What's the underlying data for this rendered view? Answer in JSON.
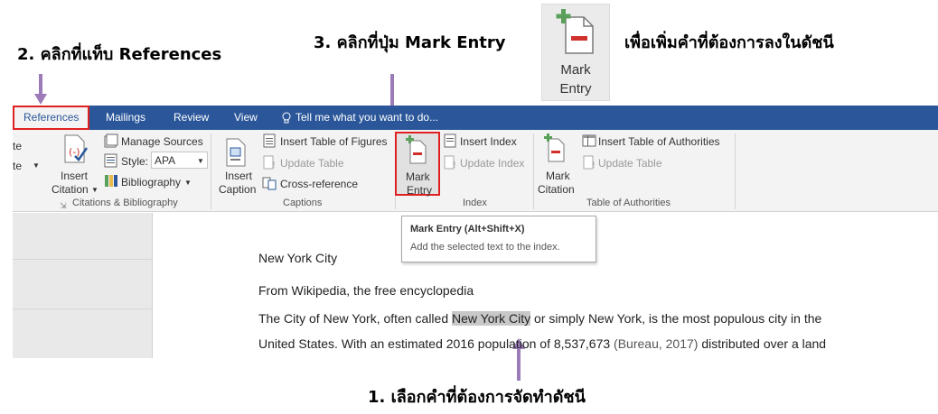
{
  "annotations": {
    "step1": "1. เลือกคำที่ต้องการจัดทำดัชนี",
    "step2": "2. คลิกที่แท็บ References",
    "step3": "3. คลิกที่ปุ่ม Mark Entry",
    "step3_suffix": "เพื่อเพิ่มคำที่ต้องการลงในดัชนี",
    "big_icon_line1": "Mark",
    "big_icon_line2": "Entry"
  },
  "tabs": {
    "references": "References",
    "mailings": "Mailings",
    "review": "Review",
    "view": "View",
    "tell_me": "Tell me what you want to do..."
  },
  "ribbon": {
    "cut_left_1": "te",
    "cut_left_2": "te",
    "citations": {
      "insert_citation_1": "Insert",
      "insert_citation_2": "Citation",
      "manage_sources": "Manage Sources",
      "style_label": "Style:",
      "style_value": "APA",
      "bibliography": "Bibliography",
      "group_label": "Citations & Bibliography"
    },
    "captions": {
      "insert_caption_1": "Insert",
      "insert_caption_2": "Caption",
      "insert_table_of_figures": "Insert Table of Figures",
      "update_table": "Update Table",
      "cross_reference": "Cross-reference",
      "group_label": "Captions"
    },
    "index": {
      "mark_entry_1": "Mark",
      "mark_entry_2": "Entry",
      "insert_index": "Insert Index",
      "update_index": "Update Index",
      "group_label": "Index"
    },
    "authorities": {
      "mark_citation_1": "Mark",
      "mark_citation_2": "Citation",
      "insert_table_of_authorities": "Insert Table of Authorities",
      "update_table": "Update Table",
      "group_label": "Table of Authorities"
    }
  },
  "tooltip": {
    "title": "Mark Entry (Alt+Shift+X)",
    "desc": "Add the selected text to the index."
  },
  "document": {
    "title": "New York City",
    "subtitle": "From Wikipedia, the free encyclopedia",
    "line1_pre": "The City of New York, often called ",
    "line1_hl": "New York City",
    "line1_post": " or simply New York, is the most populous city in the",
    "line2_pre": "United States. With an estimated 2016 population of 8,537,673 ",
    "line2_cite": "(Bureau, 2017)",
    "line2_post": " distributed over a land"
  },
  "colors": {
    "ribbon_blue": "#2b579a",
    "highlight_red": "#e02020",
    "arrow_purple": "#9b7bb8",
    "icon_green": "#5aa05a",
    "icon_red": "#d0312d"
  }
}
